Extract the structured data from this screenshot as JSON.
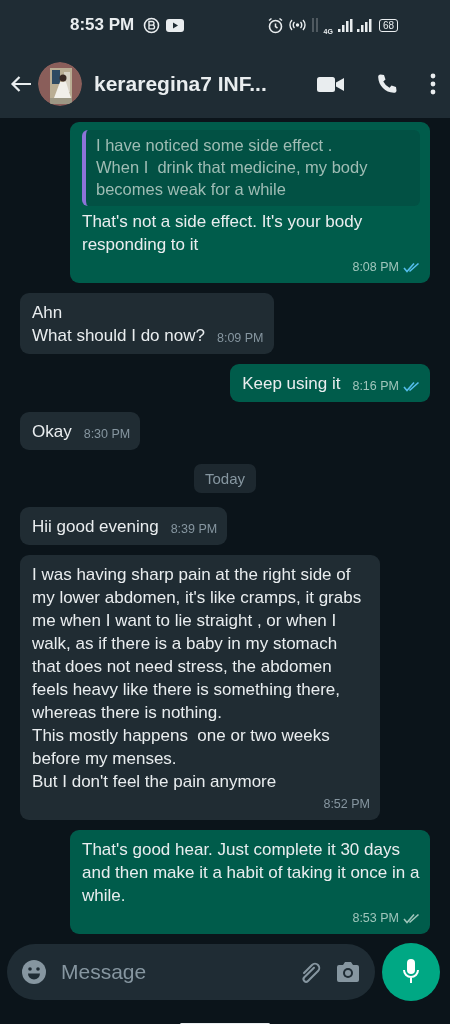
{
  "status_bar": {
    "time": "8:53 PM",
    "network": "4G",
    "battery": "68"
  },
  "header": {
    "title": "keraregina7 INF..."
  },
  "messages": [
    {
      "kind": "out",
      "quote": "I have noticed some side effect .\nWhen I  drink that medicine, my body becomes weak for a while",
      "text": "That's not a side effect. It's your body responding to it",
      "time": "8:08 PM",
      "read": true
    },
    {
      "kind": "in",
      "text": "Ahn\nWhat should I do now?",
      "time": "8:09 PM"
    },
    {
      "kind": "out",
      "text": "Keep using it",
      "time": "8:16 PM",
      "read": true
    },
    {
      "kind": "in",
      "text": "Okay",
      "time": "8:30 PM"
    },
    {
      "kind": "date",
      "text": "Today"
    },
    {
      "kind": "in",
      "text": "Hii good evening",
      "time": "8:39 PM"
    },
    {
      "kind": "in",
      "text": "I was having sharp pain at the right side of my lower abdomen, it's like cramps, it grabs me when I want to lie straight , or when I walk, as if there is a baby in my stomach that does not need stress, the abdomen feels heavy like there is something there, whereas there is nothing.\nThis mostly happens  one or two weeks before my menses.\nBut I don't feel the pain anymore",
      "time": "8:52 PM"
    },
    {
      "kind": "out",
      "text": "That's good hear. Just complete it 30 days and then make it a habit of taking it once in a while.",
      "time": "8:53 PM",
      "read": false
    }
  ],
  "composer": {
    "placeholder": "Message"
  }
}
